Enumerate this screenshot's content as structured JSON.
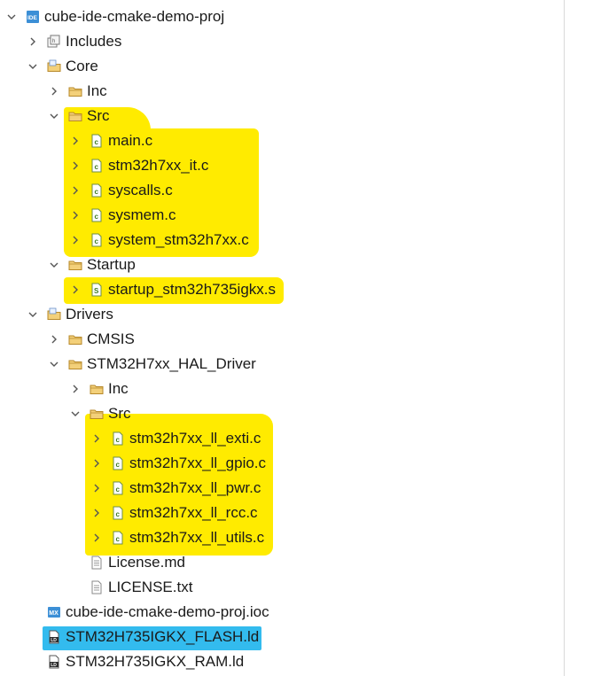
{
  "colors": {
    "highlight_yellow": "#ffeb00",
    "highlight_blue": "#33bbee",
    "folder": "#e8b64a",
    "c_file": "#5a9a3a"
  },
  "tree": {
    "project": {
      "label": "cube-ide-cmake-demo-proj",
      "icon": "ide-project-icon",
      "expanded": true
    },
    "includes": {
      "label": "Includes",
      "icon": "includes-icon",
      "expanded": false
    },
    "core": {
      "label": "Core",
      "icon": "source-folder-icon",
      "expanded": true
    },
    "core_inc": {
      "label": "Inc",
      "icon": "folder-icon",
      "expanded": false
    },
    "core_src": {
      "label": "Src",
      "icon": "folder-icon",
      "expanded": true
    },
    "core_src_files": [
      {
        "label": "main.c",
        "icon": "c-file-icon"
      },
      {
        "label": "stm32h7xx_it.c",
        "icon": "c-file-icon"
      },
      {
        "label": "syscalls.c",
        "icon": "c-file-icon"
      },
      {
        "label": "sysmem.c",
        "icon": "c-file-icon"
      },
      {
        "label": "system_stm32h7xx.c",
        "icon": "c-file-icon"
      }
    ],
    "startup": {
      "label": "Startup",
      "icon": "folder-icon",
      "expanded": true
    },
    "startup_file": {
      "label": "startup_stm32h735igkx.s",
      "icon": "asm-file-icon"
    },
    "drivers": {
      "label": "Drivers",
      "icon": "source-folder-icon",
      "expanded": true
    },
    "cmsis": {
      "label": "CMSIS",
      "icon": "folder-icon",
      "expanded": false
    },
    "hal_driver": {
      "label": "STM32H7xx_HAL_Driver",
      "icon": "folder-icon",
      "expanded": true
    },
    "hal_inc": {
      "label": "Inc",
      "icon": "folder-icon",
      "expanded": false
    },
    "hal_src": {
      "label": "Src",
      "icon": "folder-icon",
      "expanded": true
    },
    "hal_src_files": [
      {
        "label": "stm32h7xx_ll_exti.c",
        "icon": "c-file-icon"
      },
      {
        "label": "stm32h7xx_ll_gpio.c",
        "icon": "c-file-icon"
      },
      {
        "label": "stm32h7xx_ll_pwr.c",
        "icon": "c-file-icon"
      },
      {
        "label": "stm32h7xx_ll_rcc.c",
        "icon": "c-file-icon"
      },
      {
        "label": "stm32h7xx_ll_utils.c",
        "icon": "c-file-icon"
      }
    ],
    "license_md": {
      "label": "License.md",
      "icon": "text-file-icon"
    },
    "license_txt": {
      "label": "LICENSE.txt",
      "icon": "text-file-icon"
    },
    "ioc_file": {
      "label": "cube-ide-cmake-demo-proj.ioc",
      "icon": "mx-file-icon"
    },
    "flash_ld": {
      "label": "STM32H735IGKX_FLASH.ld",
      "icon": "ld-file-icon",
      "selected": true
    },
    "ram_ld": {
      "label": "STM32H735IGKX_RAM.ld",
      "icon": "ld-file-icon"
    }
  }
}
